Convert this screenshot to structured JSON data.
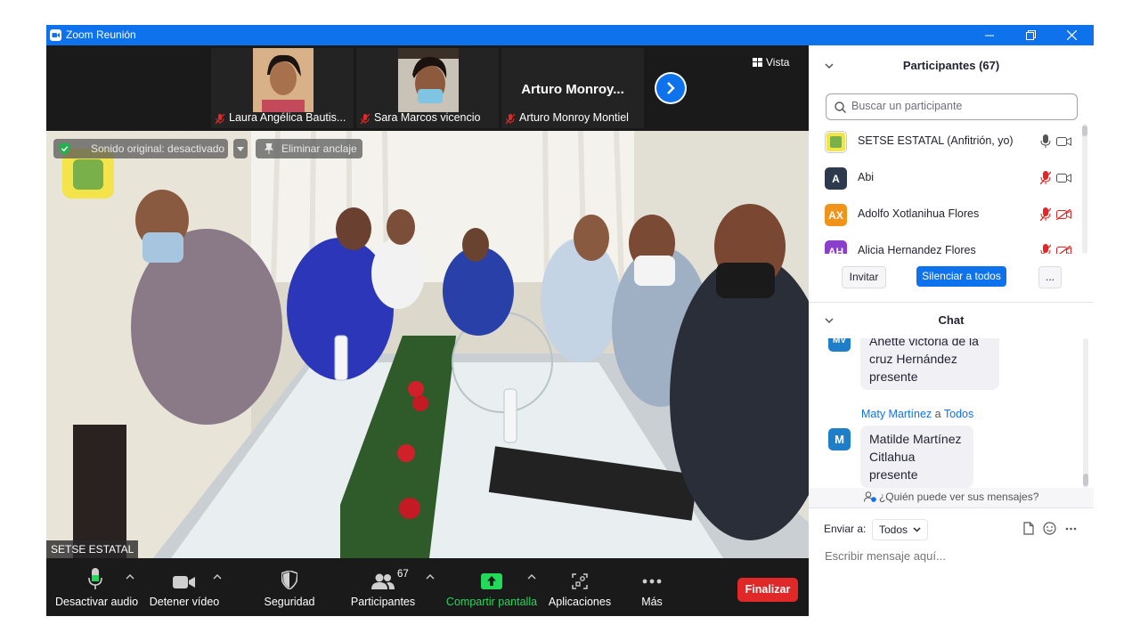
{
  "window": {
    "title": "Zoom Reunión"
  },
  "strip": {
    "tiles": [
      {
        "name": "Laura Angélica Bautis..."
      },
      {
        "name": "Sara Marcos vicencio"
      },
      {
        "name": "Arturo Monroy Montiel",
        "big_name": "Arturo  Monroy..."
      }
    ],
    "view_label": "Vista"
  },
  "main_video": {
    "original_sound": "Sonido original: desactivado",
    "unpin_label": "Eliminar anclaje",
    "speaker_name": "SETSE ESTATAL"
  },
  "toolbar": {
    "mute_label": "Desactivar audio",
    "video_label": "Detener vídeo",
    "security_label": "Seguridad",
    "participants_label": "Participantes",
    "participants_count": "67",
    "share_label": "Compartir pantalla",
    "apps_label": "Aplicaciones",
    "more_label": "Más",
    "end_label": "Finalizar"
  },
  "participants": {
    "header": "Participantes (67)",
    "search_placeholder": "Buscar un participante",
    "list": [
      {
        "name": "SETSE ESTATAL (Anfitrión, yo)",
        "initials": "",
        "color": "#ffffff"
      },
      {
        "name": "Abi",
        "initials": "A",
        "color": "#2d3a4e"
      },
      {
        "name": "Adolfo Xotlanihua Flores",
        "initials": "AX",
        "color": "#f0931b"
      },
      {
        "name": "Alicia Hernandez Flores",
        "initials": "AH",
        "color": "#8a3ec9"
      }
    ],
    "invite_label": "Invitar",
    "mute_all_label": "Silenciar a todos",
    "more_label": "..."
  },
  "chat": {
    "header": "Chat",
    "messages": [
      {
        "initials": "MV",
        "lines": [
          "Anette victoria de la",
          "cruz Hernández",
          "presente"
        ]
      },
      {
        "sender": "Maty Martínez",
        "to_word": "a",
        "to": "Todos",
        "initials": "M",
        "lines": [
          "Matilde Martínez",
          "Citlahua presente"
        ]
      }
    ],
    "who_can_see": "¿Quién puede ver sus mensajes?",
    "send_to_label": "Enviar a:",
    "send_to_value": "Todos",
    "input_placeholder": "Escribir mensaje aquí..."
  },
  "colors": {
    "accent": "#0e72ed",
    "end": "#e02828",
    "share": "#23d959"
  }
}
